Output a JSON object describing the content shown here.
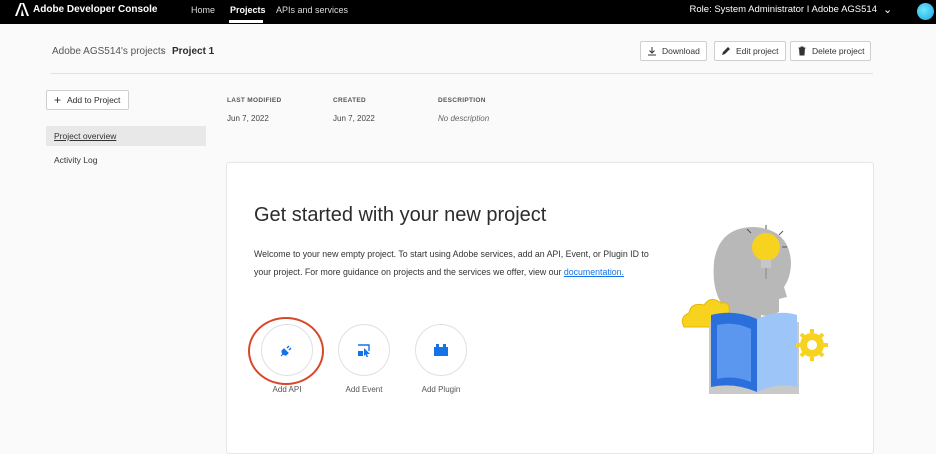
{
  "topbar": {
    "brand": "Adobe Developer Console",
    "nav": [
      "Home",
      "Projects",
      "APIs and services"
    ],
    "role": "Role: System Administrator  I  Adobe AGS514",
    "chevron": "⌄"
  },
  "header": {
    "breadcrumb_parent": "Adobe AGS514's projects",
    "breadcrumb_sep": "›",
    "breadcrumb_current": "Project 1",
    "download_label": "Download",
    "edit_label": "Edit project",
    "delete_label": "Delete project"
  },
  "sidebar": {
    "add_label": "Add to Project",
    "items": [
      {
        "label": "Project overview",
        "active": true
      },
      {
        "label": "Activity Log",
        "active": false
      }
    ]
  },
  "meta": {
    "last_modified_label": "LAST MODIFIED",
    "last_modified": "Jun 7, 2022",
    "created_label": "CREATED",
    "created": "Jun 7, 2022",
    "description_label": "DESCRIPTION",
    "description": "No description"
  },
  "card": {
    "title": "Get started with your new project",
    "body_before": "Welcome to your new empty project. To start using Adobe services, add an API, Event, or Plugin ID to your project. For more guidance on projects and the services we offer, view our ",
    "link": "documentation.",
    "actions": [
      {
        "label": "Add API",
        "icon": "plug-icon"
      },
      {
        "label": "Add Event",
        "icon": "event-icon"
      },
      {
        "label": "Add Plugin",
        "icon": "plugin-icon"
      }
    ]
  },
  "colors": {
    "accent": "#1473e6",
    "highlight": "#d9472b",
    "topbar": "#000000"
  }
}
